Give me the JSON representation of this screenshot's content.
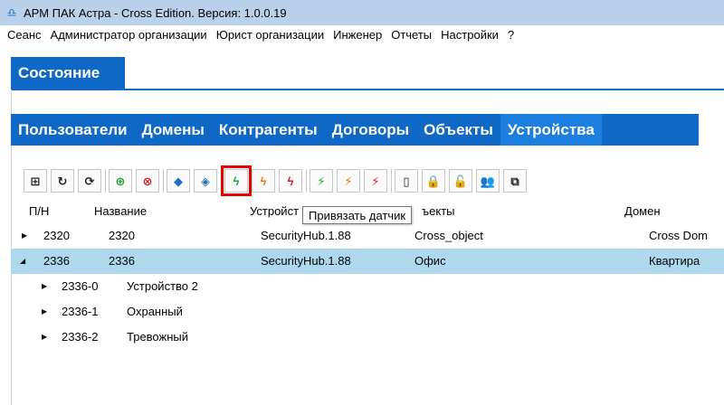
{
  "titlebar": {
    "title": "АРМ ПАК Астра - Cross Edition. Версия: 1.0.0.19"
  },
  "menu": [
    "Сеанс",
    "Администратор организации",
    "Юрист организации",
    "Инженер",
    "Отчеты",
    "Настройки",
    "?"
  ],
  "state_tab": "Состояние",
  "tabs": [
    "Пользователи",
    "Домены",
    "Контрагенты",
    "Договоры",
    "Объекты",
    "Устройства"
  ],
  "active_tab": "Устройства",
  "tooltip": "Привязать датчик",
  "table": {
    "headers": [
      "П/Н",
      "Название",
      "Устройст",
      "ъекты",
      "Домен"
    ],
    "rows": [
      {
        "pn": "2320",
        "name": "2320",
        "device": "SecurityHub.1.88",
        "object": "Cross_object",
        "domain": "Cross Dom",
        "expanded": false,
        "selected": false
      },
      {
        "pn": "2336",
        "name": "2336",
        "device": "SecurityHub.1.88",
        "object": "Офис",
        "domain": "Квартира",
        "expanded": true,
        "selected": true
      }
    ],
    "subrows": [
      {
        "pn": "2336-0",
        "name": "Устройство 2"
      },
      {
        "pn": "2336-1",
        "name": "Охранный"
      },
      {
        "pn": "2336-2",
        "name": "Тревожный"
      }
    ]
  },
  "colors": {
    "tab_blue": "#0f68c6",
    "selected_row": "#add8ee",
    "titlebar": "#b9d1ea",
    "highlight": "#e00000"
  }
}
